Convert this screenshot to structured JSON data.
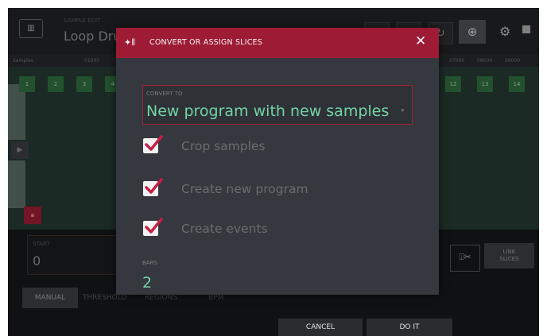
{
  "background": {
    "mode_label": "SAMPLE EDIT",
    "title": "Loop Dru",
    "ruler_ticks": [
      "Samples",
      "01000",
      "07000",
      "08000",
      "09000"
    ],
    "slice_markers": [
      "1",
      "2",
      "3",
      "4",
      "12",
      "13",
      "14"
    ],
    "start_label": "START",
    "start_value": "0",
    "link_slices_line1": "LINK",
    "link_slices_line2": "SLICES",
    "tabs": [
      "MANUAL",
      "THRESHOLD",
      "REGIONS",
      "BPM"
    ],
    "active_tab": "MANUAL"
  },
  "modal": {
    "title": "CONVERT OR ASSIGN SLICES",
    "convert_to_label": "CONVERT TO",
    "convert_to_value": "New program with new samples",
    "options": [
      {
        "label": "Crop samples",
        "checked": true
      },
      {
        "label": "Create new program",
        "checked": true
      },
      {
        "label": "Create events",
        "checked": true
      }
    ],
    "bars_label": "BARS",
    "bars_value": "2"
  },
  "footer": {
    "cancel_label": "CANCEL",
    "do_it_label": "DO IT"
  },
  "colors": {
    "accent_red": "#9e1b35",
    "value_green": "#74d4a7",
    "check_red": "#c81e44"
  }
}
